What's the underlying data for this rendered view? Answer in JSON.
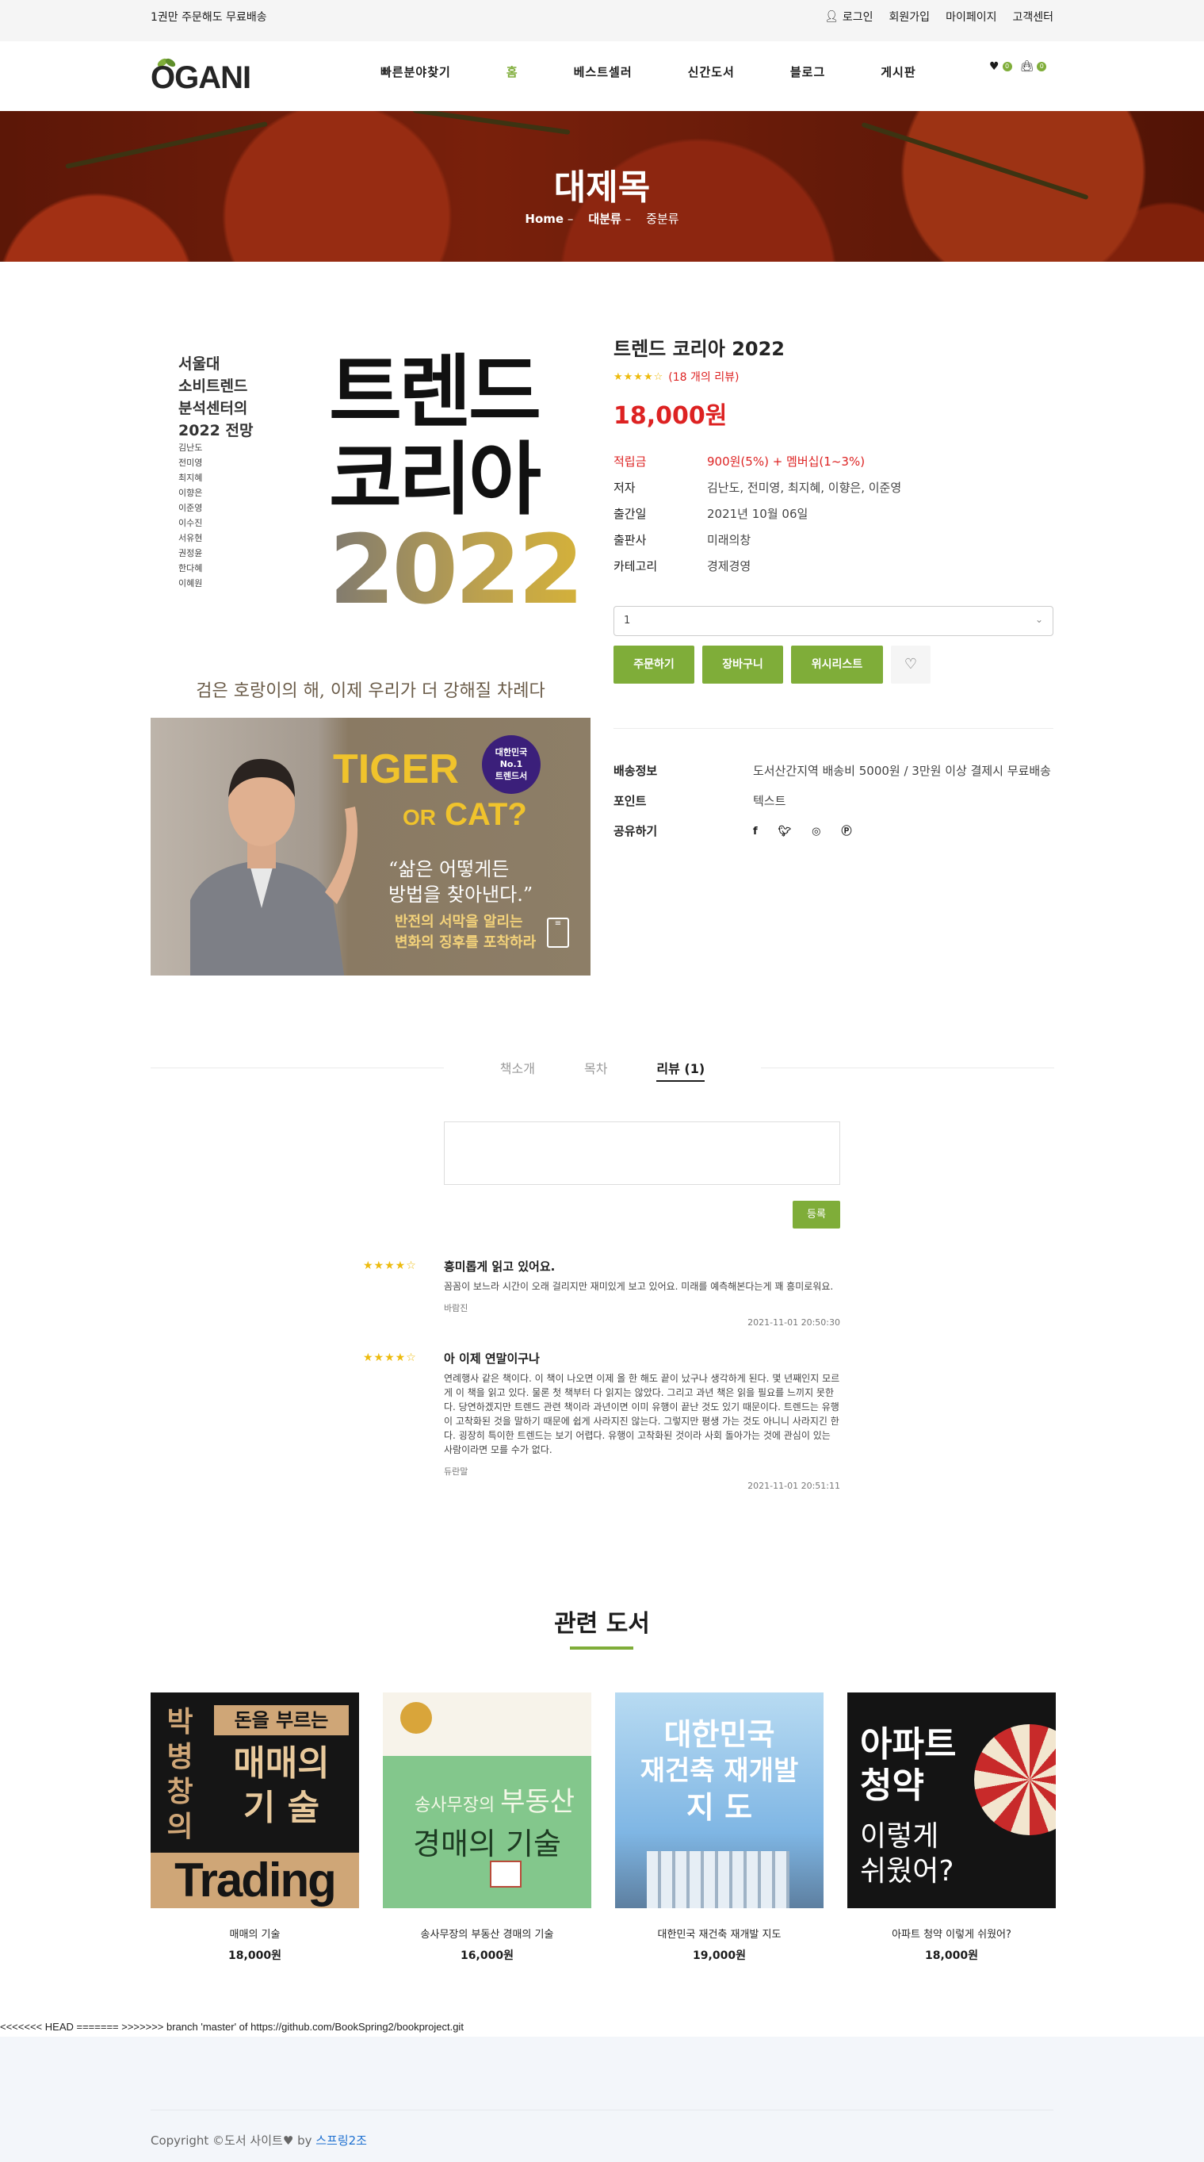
{
  "topbar": {
    "message": "1권만 주문해도 무료배송",
    "login": "로그인",
    "signup": "회원가입",
    "mypage": "마이페이지",
    "support": "고객센터"
  },
  "header": {
    "logo": "OGANI",
    "nav": [
      "빠른분야찾기",
      "홈",
      "베스트셀러",
      "신간도서",
      "블로그",
      "게시판"
    ],
    "wishlist_count": "0",
    "cart_count": "0"
  },
  "hero": {
    "title": "대제목",
    "crumb_home": "Home",
    "crumb_major": "대분류",
    "crumb_minor": "중분류"
  },
  "cover": {
    "left_title": [
      "서울대",
      "소비트렌드",
      "분석센터의",
      "2022 전망"
    ],
    "authors": [
      "김난도",
      "전미영",
      "최지혜",
      "이향은",
      "이준영",
      "이수진",
      "서유현",
      "권정윤",
      "한다혜",
      "이혜원"
    ],
    "big_line1": "트렌드",
    "big_line2": "코리아",
    "year": "2022",
    "tagline": "검은 호랑이의 해, 이제 우리가 더 강해질 차례다",
    "banner_tiger": "TIGER",
    "banner_or": "OR",
    "banner_cat": "CAT?",
    "badge": [
      "대한민국",
      "No.1",
      "트렌드서"
    ],
    "quote": [
      "“삶은 어떻게든",
      "방법을 찾아낸다.”"
    ],
    "sub": [
      "반전의 서막을 알리는",
      "변화의 징후를 포착하라"
    ]
  },
  "product": {
    "title": "트렌드 코리아 2022",
    "rating": "★★★★☆",
    "reviews": "(18 개의 리뷰)",
    "price": "18,000원",
    "points_label": "적립금",
    "points_value": "900원(5%) + 멤버십(1~3%)",
    "author_label": "저자",
    "author_value": "김난도, 전미영, 최지혜, 이향은, 이준영",
    "date_label": "출간일",
    "date_value": "2021년 10월 06일",
    "publisher_label": "출판사",
    "publisher_value": "미래의창",
    "category_label": "카테고리",
    "category_value": "경제경영",
    "quantity": "1",
    "order_button": "주문하기",
    "cart_button": "장바구니",
    "wishlist_button": "위시리스트"
  },
  "shipping": {
    "ship_label": "배송정보",
    "ship_value": "도서산간지역 배송비 5000원 / 3만원 이상 결제시 무료배송",
    "point_label": "포인트",
    "point_value": "텍스트",
    "share_label": "공유하기"
  },
  "tabs": {
    "intro": "책소개",
    "toc": "목차",
    "review": "리뷰 (1)"
  },
  "review_form": {
    "submit": "등록"
  },
  "reviews": [
    {
      "stars": "★★★★☆",
      "title": "흥미롭게 읽고 있어요.",
      "content": "꼼꼼이 보느라 시간이 오래 걸리지만 재미있게 보고 있어요. 미래를 예측해본다는게 꽤 흥미로워요.",
      "author": "바람진",
      "date": "2021-11-01 20:50:30"
    },
    {
      "stars": "★★★★☆",
      "title": "아 이제 연말이구나",
      "content": "연례행사 같은 책이다. 이 책이 나오면 이제 올 한 해도 끝이 났구나 생각하게 된다. 몇 년째인지 모르게 이 책을 읽고 있다. 물론 첫 책부터 다 읽지는 않았다. 그리고 과년 책은 읽을 필요를 느끼지 못한다. 당연하겠지만 트렌드 관련 책이라 과년이면 이미 유행이 끝난 것도 있기 때문이다. 트렌드는 유행이 고착화된 것을 말하기 때문에 쉽게 사라지진 않는다. 그렇지만 평생 가는 것도 아니니 사라지긴 한다. 굉장히 특이한 트렌드는 보기 어렵다. 유행이 고착화된 것이라 사회 돌아가는 것에 관심이 있는 사람이라면 모를 수가 없다.",
      "author": "듀란말",
      "date": "2021-11-01 20:51:11"
    }
  ],
  "related": {
    "title": "관련 도서",
    "books": [
      {
        "title": "매매의 기술",
        "price": "18,000원"
      },
      {
        "title": "송사무장의 부동산 경매의 기술",
        "price": "16,000원"
      },
      {
        "title": "대한민국 재건축 재개발 지도",
        "price": "19,000원"
      },
      {
        "title": "아파트 청약 이렇게 쉬웠어?",
        "price": "18,000원"
      }
    ],
    "covers": {
      "b1_top": "돈을 부르는",
      "b1_side": [
        "박",
        "병",
        "창",
        "의"
      ],
      "b1_main": [
        "매매의",
        "기 술"
      ],
      "b1_bottom": "Trading",
      "b2_small": "송사무장의",
      "b2_sub": "부동산",
      "b2_main": "경매의 기술",
      "b3_top": "대한민국",
      "b3_mid": "재건축 재개발",
      "b3_bot": "지  도",
      "b4_main": [
        "아파트",
        "청약"
      ],
      "b4_sub": [
        "이렇게",
        "쉬웠어?"
      ]
    }
  },
  "conflict_text": "<<<<<<< HEAD ======= >>>>>>> branch 'master' of https://github.com/BookSpring2/bookproject.git",
  "footer": {
    "copyright": "Copyright ©도서 사이트",
    "by": " by ",
    "team": "스프링2조"
  }
}
